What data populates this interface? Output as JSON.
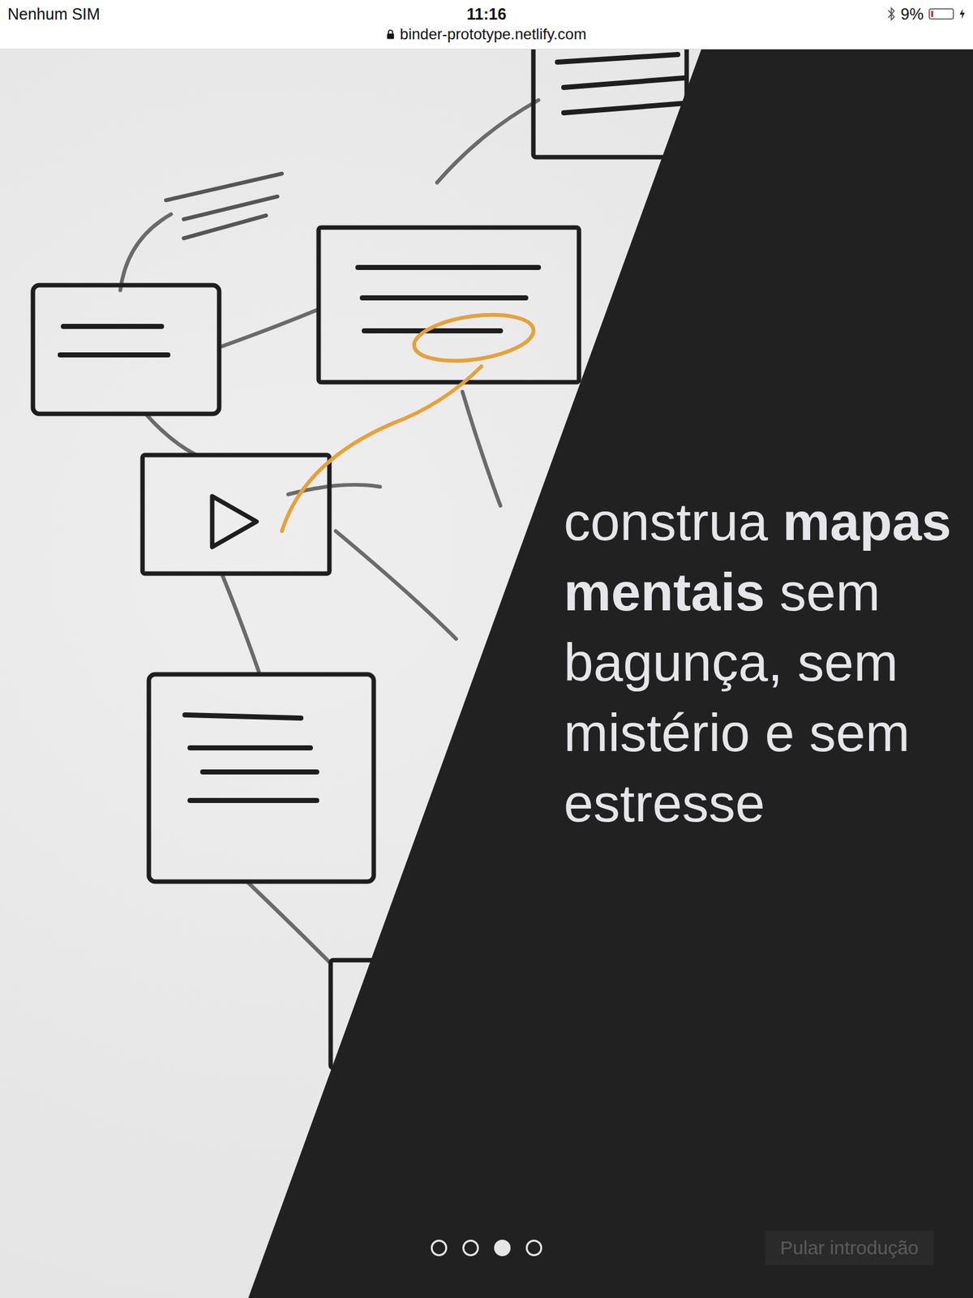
{
  "status_bar": {
    "carrier": "Nenhum SIM",
    "time": "11:16",
    "battery": "9%",
    "battery_level": 0.09,
    "url": "binder-prototype.netlify.com"
  },
  "headline": [
    {
      "text": "construa ",
      "bold": false
    },
    {
      "text": "mapas mentais",
      "bold": true
    },
    {
      "text": " sem bagunça, sem mistério e sem estresse",
      "bold": false
    }
  ],
  "pages": [
    {
      "selected": false
    },
    {
      "selected": false
    },
    {
      "selected": true
    },
    {
      "selected": false
    }
  ],
  "skip_button": "Pular introdução"
}
